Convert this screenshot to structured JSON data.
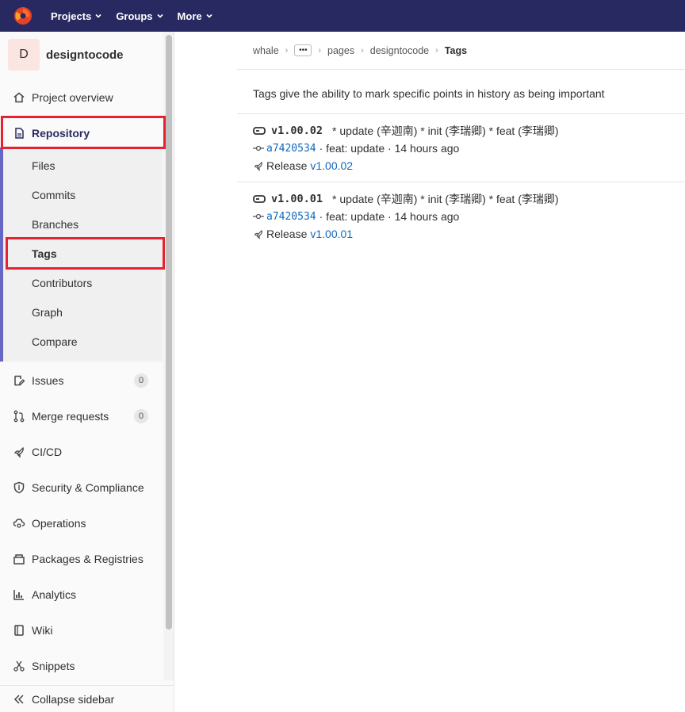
{
  "topbar": {
    "nav": [
      {
        "label": "Projects"
      },
      {
        "label": "Groups"
      },
      {
        "label": "More"
      }
    ]
  },
  "sidebar": {
    "avatar_letter": "D",
    "project_name": "designtocode",
    "project_overview": "Project overview",
    "repository": "Repository",
    "repo_sub": [
      "Files",
      "Commits",
      "Branches",
      "Tags",
      "Contributors",
      "Graph",
      "Compare"
    ],
    "issues": {
      "label": "Issues",
      "count": "0"
    },
    "merge_requests": {
      "label": "Merge requests",
      "count": "0"
    },
    "cicd": "CI/CD",
    "security": "Security & Compliance",
    "operations": "Operations",
    "packages": "Packages & Registries",
    "analytics": "Analytics",
    "wiki": "Wiki",
    "snippets": "Snippets",
    "collapse": "Collapse sidebar"
  },
  "breadcrumb": {
    "items": [
      "whale",
      "pages",
      "designtocode"
    ],
    "current": "Tags"
  },
  "description": "Tags give the ability to mark specific points in history as being important",
  "tags": [
    {
      "name": "v1.00.02",
      "message": "* update (辛迦南) * init (李瑞卿) * feat (李瑞卿)",
      "sha": "a7420534",
      "commit_info": "· feat: update · 14 hours ago",
      "release_label": "Release",
      "release_link": "v1.00.02"
    },
    {
      "name": "v1.00.01",
      "message": "* update (辛迦南) * init (李瑞卿) * feat (李瑞卿)",
      "sha": "a7420534",
      "commit_info": "· feat: update · 14 hours ago",
      "release_label": "Release",
      "release_link": "v1.00.01"
    }
  ],
  "colors": {
    "topbar": "#292961",
    "accent": "#6666c4",
    "highlight": "#e5222f",
    "link": "#1068bf"
  }
}
